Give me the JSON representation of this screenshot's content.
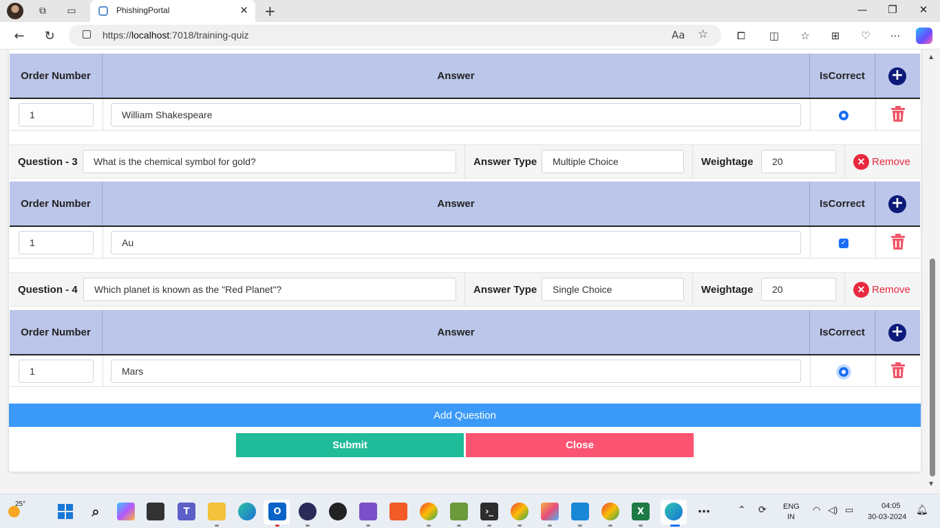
{
  "browser": {
    "tab_title": "PhishingPortal",
    "url_prefix": "https://",
    "url_host": "localhost",
    "url_rest": ":7018/training-quiz"
  },
  "table_headers": {
    "order_number": "Order Number",
    "answer": "Answer",
    "is_correct": "IsCorrect"
  },
  "labels": {
    "answer_type": "Answer Type",
    "weightage": "Weightage",
    "remove": "Remove"
  },
  "answer_blocks": [
    {
      "order": "1",
      "answer": "William Shakespeare",
      "correct_control": "radio"
    },
    {
      "order": "1",
      "answer": "Au",
      "correct_control": "checkbox"
    },
    {
      "order": "1",
      "answer": "Mars",
      "correct_control": "radio"
    }
  ],
  "questions": [
    {
      "label": "Question - 3",
      "text": "What is the chemical symbol for gold?",
      "answer_type": "Multiple Choice",
      "weightage": "20"
    },
    {
      "label": "Question - 4",
      "text": "Which planet is known as the \"Red Planet\"?",
      "answer_type": "Single Choice",
      "weightage": "20"
    }
  ],
  "buttons": {
    "add_question": "Add Question",
    "submit": "Submit",
    "close": "Close"
  },
  "taskbar": {
    "temperature": "25°",
    "language_top": "ENG",
    "language_bottom": "IN",
    "time": "04:05",
    "date": "30-03-2024"
  },
  "colors": {
    "table_header": "#bcc6ea",
    "add_question": "#3b9af8",
    "submit": "#20bb98",
    "close": "#fb5472",
    "remove": "#e8293f",
    "plus": "#0d1a7a"
  }
}
